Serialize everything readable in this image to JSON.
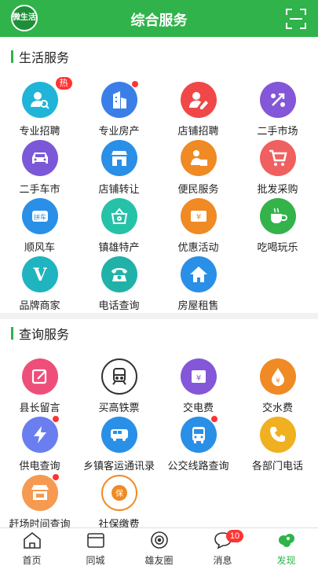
{
  "header": {
    "logo_text": "微生活",
    "title": "综合服务"
  },
  "sections": {
    "life": {
      "title": "生活服务"
    },
    "query": {
      "title": "查询服务"
    }
  },
  "life_items": [
    {
      "label": "专业招聘",
      "badge": "热"
    },
    {
      "label": "专业房产"
    },
    {
      "label": "店铺招聘"
    },
    {
      "label": "二手市场"
    },
    {
      "label": "二手车市"
    },
    {
      "label": "店铺转让"
    },
    {
      "label": "便民服务"
    },
    {
      "label": "批发采购"
    },
    {
      "label": "顺风车",
      "icon_text": "拼车"
    },
    {
      "label": "镇雄特产"
    },
    {
      "label": "优惠活动",
      "icon_text": "¥"
    },
    {
      "label": "吃喝玩乐"
    },
    {
      "label": "品牌商家",
      "icon_text": "V"
    },
    {
      "label": "电话查询"
    },
    {
      "label": "房屋租售"
    }
  ],
  "query_items": [
    {
      "label": "县长留言"
    },
    {
      "label": "买高铁票"
    },
    {
      "label": "交电费",
      "icon_text": "¥"
    },
    {
      "label": "交水费",
      "icon_text": "¥"
    },
    {
      "label": "供电查询"
    },
    {
      "label": "乡镇客运通讯录"
    },
    {
      "label": "公交线路查询"
    },
    {
      "label": "各部门电话"
    },
    {
      "label": "赶场时间查询"
    },
    {
      "label": "社保缴费",
      "icon_text": "保"
    }
  ],
  "tabs": [
    {
      "label": "首页"
    },
    {
      "label": "同城"
    },
    {
      "label": "雄友圈"
    },
    {
      "label": "消息",
      "badge": "10"
    },
    {
      "label": "发现"
    }
  ],
  "colors": {
    "brand": "#2fb34a",
    "badge": "#ff3333"
  }
}
